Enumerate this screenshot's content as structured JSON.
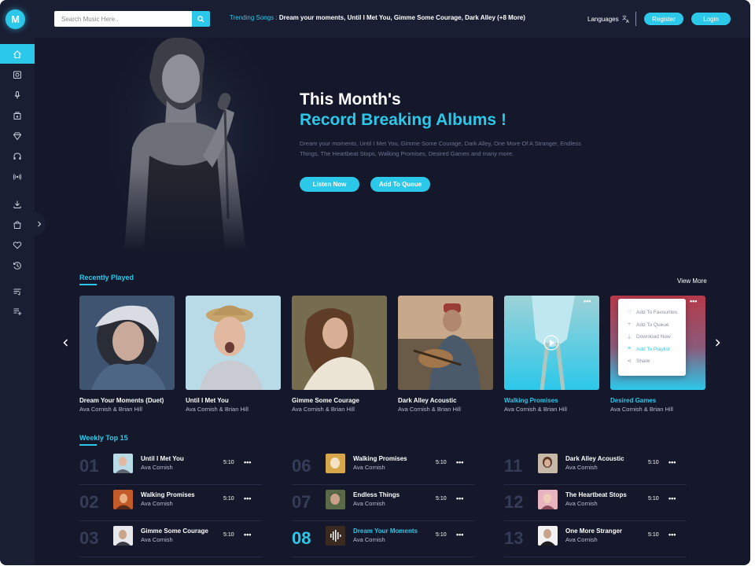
{
  "brand": {
    "logo_letter": "M"
  },
  "search": {
    "placeholder": "Search Music Here.."
  },
  "trending": {
    "label": "Trending Songs :",
    "songs": "Dream your moments, Until I Met You, Gimme Some Courage, Dark Alley (+8 More)"
  },
  "header": {
    "languages_label": "Languages",
    "register_label": "Register",
    "login_label": "Login"
  },
  "sidebar": {
    "items": [
      "home-icon",
      "album-icon",
      "microphone-icon",
      "music-store-icon",
      "diamond-icon",
      "headphones-icon",
      "radio-icon",
      "download-icon",
      "bag-icon",
      "heart-icon",
      "history-icon",
      "playlist-icon",
      "add-playlist-icon"
    ]
  },
  "hero": {
    "title_line1": "This Month's",
    "title_line2": "Record Breaking Albums !",
    "description": "Dream your moments, Until I Met You, Gimme Some Courage, Dark Alley, One More Of A Stranger, Endless Things, The Heartbeat Stops, Walking Promises, Desired Games and many more.",
    "listen_label": "Listen Now",
    "queue_label": "Add To Queue"
  },
  "recently_played": {
    "title": "Recently Played",
    "view_more": "View More",
    "cards": [
      {
        "title": "Dream Your Moments (Duet)",
        "artist": "Ava Cornish & Brian Hill"
      },
      {
        "title": "Until I Met You",
        "artist": "Ava Cornish & Brian Hill"
      },
      {
        "title": "Gimme Some Courage",
        "artist": "Ava Cornish & Brian Hill"
      },
      {
        "title": "Dark Alley Acoustic",
        "artist": "Ava Cornish & Brian Hill"
      },
      {
        "title": "Walking Promises",
        "artist": "Ava Cornish & Brian Hill"
      },
      {
        "title": "Desired Games",
        "artist": "Ava Cornish & Brian Hill"
      }
    ],
    "context_menu": [
      "Add To Favourites",
      "Add To Queue",
      "Download Now",
      "Add To Playlist",
      "Share"
    ]
  },
  "weekly": {
    "title": "Weekly Top 15",
    "rows": [
      {
        "num": "01",
        "song": "Until I Met You",
        "artist": "Ava Cornish",
        "duration": "5:10"
      },
      {
        "num": "02",
        "song": "Walking Promises",
        "artist": "Ava Cornish",
        "duration": "5:10"
      },
      {
        "num": "03",
        "song": "Gimme Some Courage",
        "artist": "Ava Cornish",
        "duration": "5:10"
      },
      {
        "num": "06",
        "song": "Walking Promises",
        "artist": "Ava Cornish",
        "duration": "5:10"
      },
      {
        "num": "07",
        "song": "Endless Things",
        "artist": "Ava Cornish",
        "duration": "5:10"
      },
      {
        "num": "08",
        "song": "Dream Your Moments",
        "artist": "Ava Cornish",
        "duration": "5:10"
      },
      {
        "num": "11",
        "song": "Dark Alley Acoustic",
        "artist": "Ava Cornish",
        "duration": "5:10"
      },
      {
        "num": "12",
        "song": "The Heartbeat Stops",
        "artist": "Ava Cornish",
        "duration": "5:10"
      },
      {
        "num": "13",
        "song": "One More Stranger",
        "artist": "Ava Cornish",
        "duration": "5:10"
      }
    ]
  },
  "colors": {
    "accent": "#2cc8ea",
    "background": "#14182a",
    "panel": "#1a1e33"
  }
}
